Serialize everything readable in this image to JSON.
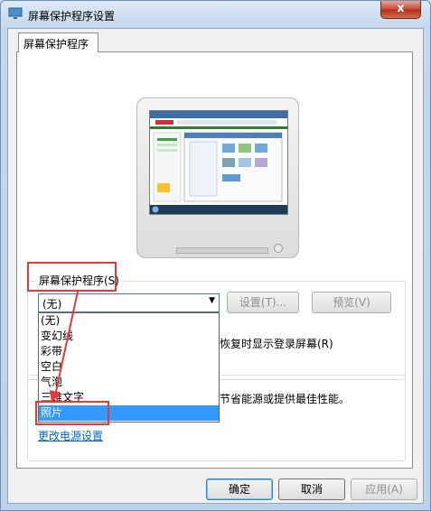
{
  "window": {
    "title": "屏幕保护程序设置",
    "close_glyph": "x"
  },
  "tab": {
    "label": "屏幕保护程序"
  },
  "screensaver_group": {
    "title": "屏幕保护程序(S)",
    "selected": "(无)",
    "settings_label": "设置(T)...",
    "preview_label": "预览(V)",
    "options": [
      "(无)",
      "变幻线",
      "彩带",
      "空白",
      "气泡",
      "三维文字",
      "照片"
    ],
    "highlighted_option": "照片",
    "resume_text_visible": "恢复时显示登录屏幕(R)"
  },
  "power_group": {
    "text_visible": "节省能源或提供最佳性能。",
    "link": "更改电源设置"
  },
  "footer": {
    "ok": "确定",
    "cancel": "取消",
    "apply": "应用(A)"
  },
  "colors": {
    "accent": "#3399ff",
    "annotation": "#e53935",
    "link": "#0066cc"
  }
}
